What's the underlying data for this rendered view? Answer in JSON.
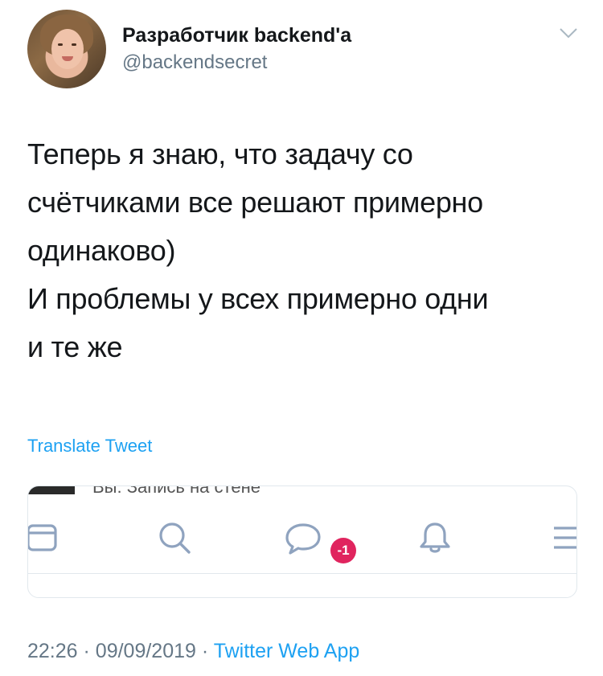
{
  "author": {
    "display_name": "Разработчик backend'a",
    "handle": "@backendsecret"
  },
  "tweet": {
    "lines": [
      "Теперь я знаю, что задачу со",
      "счётчиками все решают примерно",
      "одинаково)",
      "И проблемы у всех примерно одни",
      "и те же"
    ],
    "translate_label": "Translate Tweet"
  },
  "embedded_card": {
    "peek_text": "Вы: Запись на стене",
    "nav_icons": [
      "news-icon",
      "search-icon",
      "messages-icon",
      "notifications-icon",
      "menu-icon"
    ],
    "messages_badge": "-1"
  },
  "meta": {
    "time": "22:26",
    "separator": "·",
    "date": "09/09/2019",
    "source": "Twitter Web App"
  },
  "colors": {
    "accent": "#1da1f2",
    "text": "#14171a",
    "secondary": "#657786",
    "badge": "#e0245e",
    "vk_icons": "#8fa3bf"
  }
}
